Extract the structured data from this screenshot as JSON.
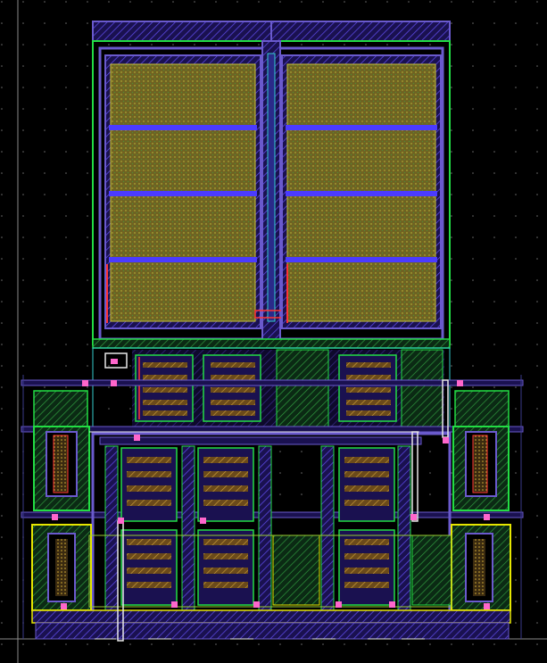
{
  "app": {
    "view": "layout-editor-canvas"
  },
  "colors": {
    "background": "#000000",
    "grid_dot": "#6a6a6a",
    "metal1": "#6a5acd",
    "metal2": "#4b3bff",
    "poly": "#ff3333",
    "diffusion": "#33cc33",
    "nwell": "#9acd32",
    "cap_fill": "#8b7a2a",
    "contact": "#ff66cc",
    "outline_green": "#22dd44",
    "outline_yellow": "#e6e600",
    "outline_cyan": "#33cccc",
    "white_wire": "#e8e8e8"
  },
  "layers": [
    "metal1",
    "metal2",
    "poly",
    "diffusion",
    "nwell",
    "contact"
  ],
  "grid": {
    "visible": true,
    "style": "dots"
  }
}
